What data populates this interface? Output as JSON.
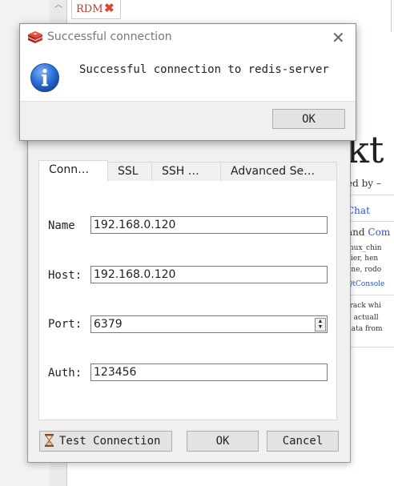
{
  "background_app": {
    "tab_label": "RDM",
    "tab_close_glyph": "✖",
    "heading_fragment": "kt",
    "created_by": "ed by –",
    "chat_link": "Chat",
    "and_com": "and",
    "com_link": "Com",
    "line1": "inux_chin",
    "line2": "cier, hen",
    "line3": "one, rodo",
    "line4": "QtConsole",
    "line5": "track whi",
    "line6": "u actuall",
    "line7": "data from"
  },
  "message_box": {
    "title": "Successful connection",
    "message": "Successful connection to redis-server",
    "ok_label": "OK",
    "close_glyph": "✕"
  },
  "connection_dialog": {
    "tabs": [
      "Conn…",
      "SSL",
      "SSH …",
      "Advanced Se…"
    ],
    "fields": {
      "name": {
        "label": "Name",
        "value": "192.168.0.120"
      },
      "host": {
        "label": "Host:",
        "value": "192.168.0.120"
      },
      "port": {
        "label": "Port:",
        "value": "6379"
      },
      "auth": {
        "label": "Auth:",
        "value": "123456"
      }
    },
    "buttons": {
      "test": "Test Connection",
      "ok": "OK",
      "cancel": "Cancel"
    }
  },
  "colors": {
    "redis_red": "#d82c20",
    "info_blue": "#1f5fbf",
    "link_blue": "#2a56c6"
  }
}
